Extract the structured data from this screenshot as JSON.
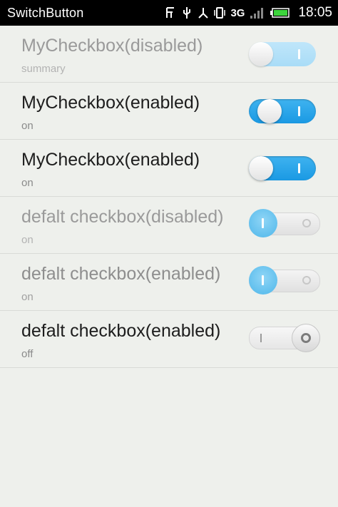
{
  "status_bar": {
    "app_title": "SwitchButton",
    "network": "3G",
    "time": "18:05",
    "icons": [
      "sim-icon",
      "usb-icon",
      "usb-debug-icon",
      "vibrate-icon",
      "network-3g-icon",
      "signal-icon",
      "battery-icon"
    ]
  },
  "items": [
    {
      "title": "MyCheckbox(disabled)",
      "summary": "summary",
      "state": "on",
      "enabled": false
    },
    {
      "title": "MyCheckbox(enabled)",
      "summary": "on",
      "state": "on",
      "enabled": true
    },
    {
      "title": "MyCheckbox(enabled)",
      "summary": "on",
      "state": "on",
      "enabled": true
    },
    {
      "title": "defalt checkbox(disabled)",
      "summary": "on",
      "state": "on",
      "enabled": false
    },
    {
      "title": "defalt checkbox(enabled)",
      "summary": "on",
      "state": "on",
      "enabled": true
    },
    {
      "title": "defalt checkbox(enabled)",
      "summary": "off",
      "state": "off",
      "enabled": true
    }
  ],
  "colors": {
    "accent": "#1a99e3",
    "accent_disabled": "#a9dcf7",
    "background": "#eef0ec",
    "status_bar": "#000000"
  }
}
